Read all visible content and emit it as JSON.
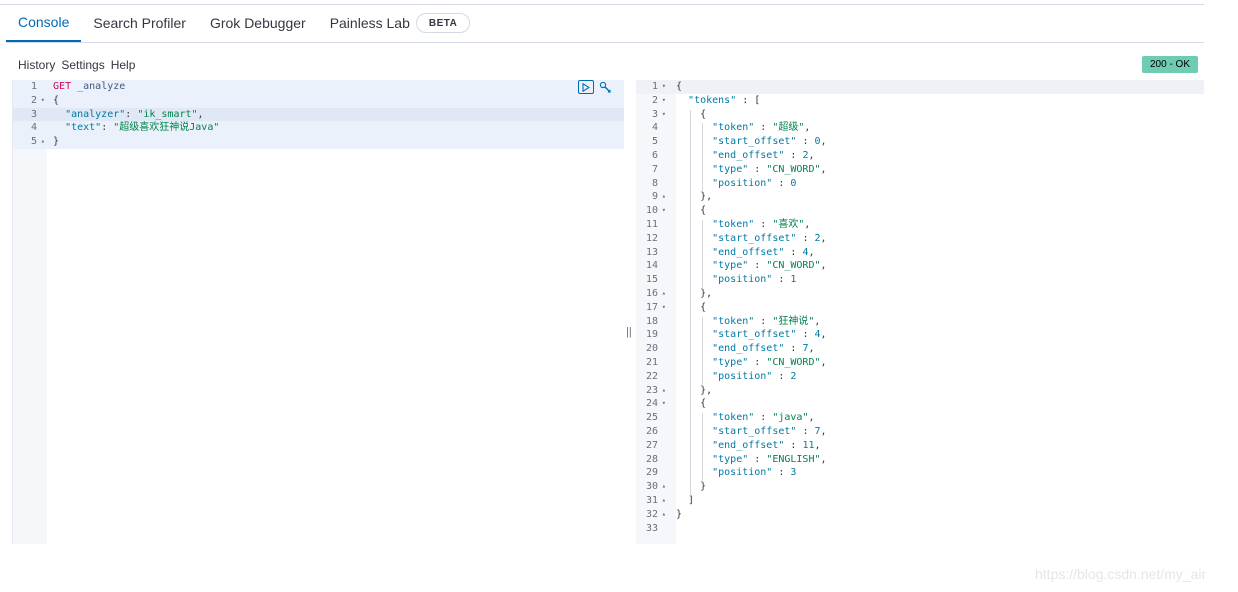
{
  "tabs": [
    {
      "label": "Console",
      "active": true
    },
    {
      "label": "Search Profiler",
      "active": false
    },
    {
      "label": "Grok Debugger",
      "active": false
    },
    {
      "label": "Painless Lab",
      "active": false
    }
  ],
  "beta_badge": "BETA",
  "menu": {
    "history": "History",
    "settings": "Settings",
    "help": "Help"
  },
  "status": "200 - OK",
  "request": {
    "method": "GET",
    "path": "_analyze",
    "analyzer_key": "\"analyzer\"",
    "analyzer_value": "\"ik_smart\"",
    "text_key": "\"text\"",
    "text_value": "\"超级喜欢狂神说Java\"",
    "line_numbers": [
      "1",
      "2",
      "3",
      "4",
      "5"
    ]
  },
  "response": {
    "tokens_key": "\"tokens\"",
    "tokens": [
      {
        "token": "\"超级\"",
        "start_offset": "0",
        "end_offset": "2",
        "type": "\"CN_WORD\"",
        "position": "0"
      },
      {
        "token": "\"喜欢\"",
        "start_offset": "2",
        "end_offset": "4",
        "type": "\"CN_WORD\"",
        "position": "1"
      },
      {
        "token": "\"狂神说\"",
        "start_offset": "4",
        "end_offset": "7",
        "type": "\"CN_WORD\"",
        "position": "2"
      },
      {
        "token": "\"java\"",
        "start_offset": "7",
        "end_offset": "11",
        "type": "\"ENGLISH\"",
        "position": "3"
      }
    ],
    "field_keys": {
      "token": "\"token\"",
      "start_offset": "\"start_offset\"",
      "end_offset": "\"end_offset\"",
      "type": "\"type\"",
      "position": "\"position\""
    },
    "line_count": 33,
    "fold_lines": [
      1,
      2,
      3,
      9,
      10,
      16,
      17,
      23,
      24,
      30,
      31,
      32
    ]
  },
  "icons": {
    "play": "play-icon",
    "wrench": "wrench-icon",
    "resizer": "resize-handle-icon"
  },
  "watermark": "https://blog.csdn.net/my_air",
  "colors": {
    "accent": "#006bb4",
    "status_bg": "#6dccb1"
  }
}
